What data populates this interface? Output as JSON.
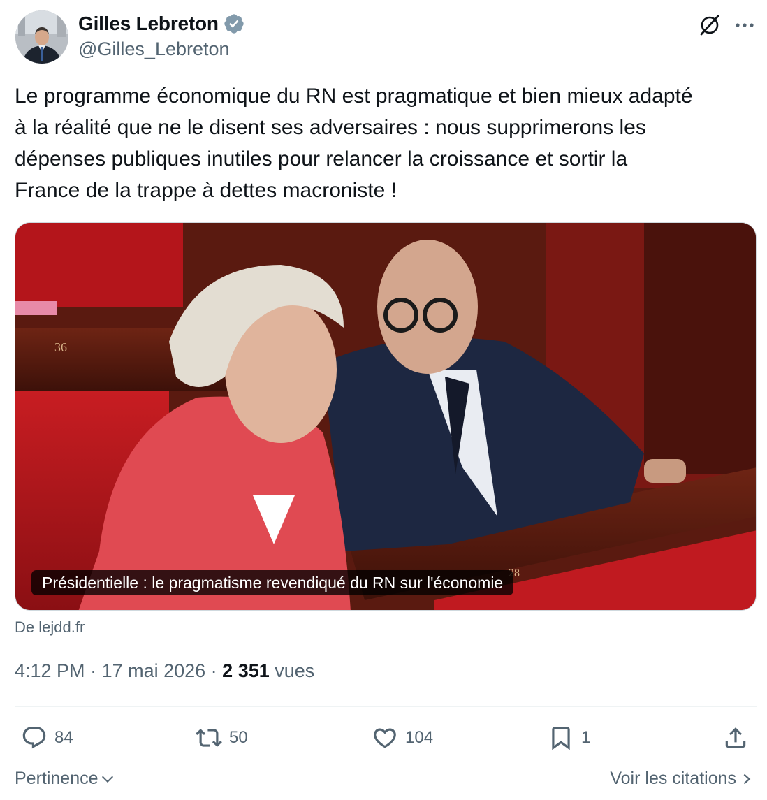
{
  "author": {
    "display_name": "Gilles Lebreton",
    "handle": "@Gilles_Lebreton",
    "verified": true
  },
  "tweet": {
    "text": "Le programme économique du RN est pragmatique et bien mieux adapté\nà la réalité que ne le disent ses adversaires : nous supprimerons les\ndépenses publiques inutiles pour relancer la croissance et sortir la\nFrance de la trappe à dettes macroniste !"
  },
  "card": {
    "caption": "Présidentielle : le pragmatisme revendiqué du RN sur l'économie",
    "source": "De lejdd.fr",
    "bench_number_left": "36",
    "bench_number_bottom": "28"
  },
  "meta": {
    "time": "4:12 PM",
    "separator": " · ",
    "date": "17 mai 2026",
    "views_count": "2 351",
    "views_label": "vues"
  },
  "actions": {
    "replies": "84",
    "reposts": "50",
    "likes": "104",
    "bookmarks": "1"
  },
  "footer": {
    "sort_label": "Pertinence",
    "quotes_label": "Voir les citations"
  },
  "icons": {
    "verified": "verified-badge-icon",
    "grok": "grok-icon",
    "more": "more-options-icon",
    "reply": "reply-icon",
    "repost": "repost-icon",
    "like": "like-icon",
    "bookmark": "bookmark-icon",
    "share": "share-icon"
  },
  "colors": {
    "text_primary": "#0f1419",
    "text_secondary": "#536471",
    "verified_badge": "#829aab",
    "divider": "#eff3f4"
  }
}
